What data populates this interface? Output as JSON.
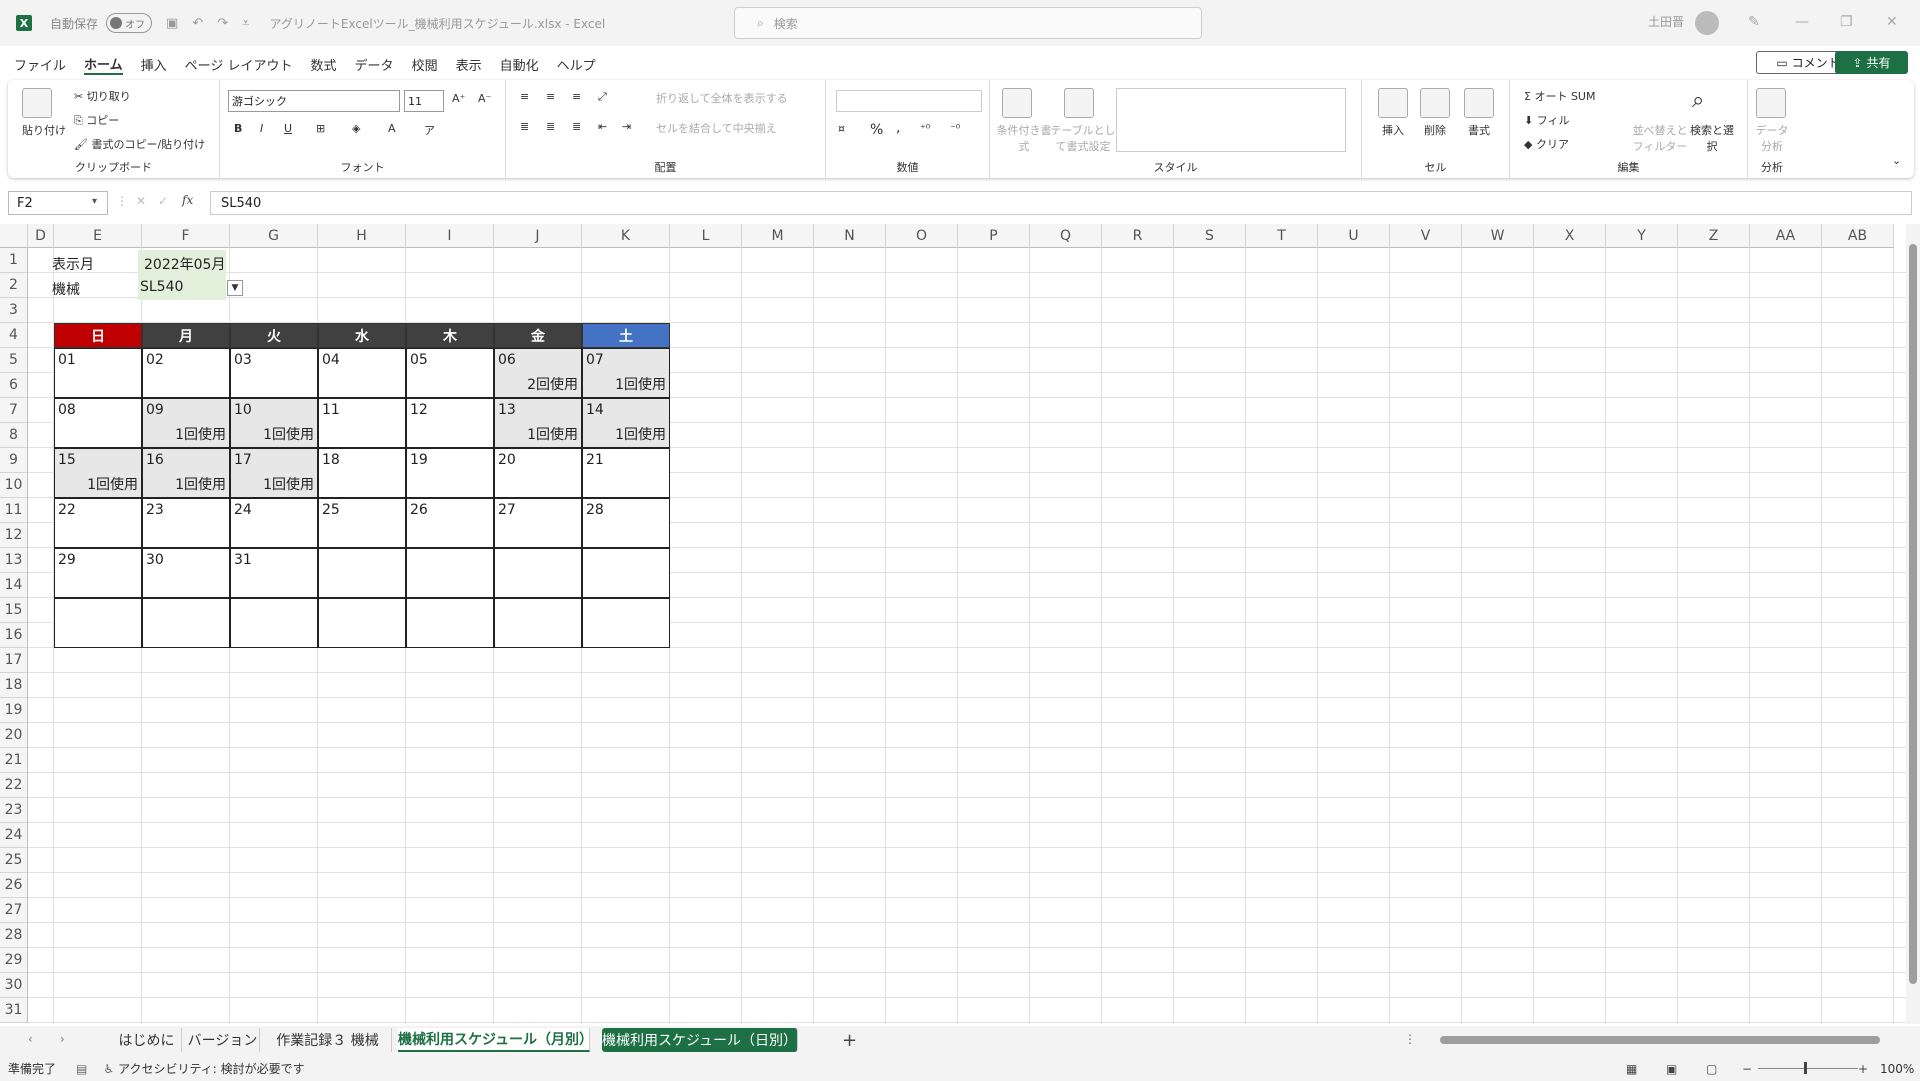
{
  "titlebar": {
    "autosave_label": "自動保存",
    "autosave_state": "オフ",
    "doc_title": "アグリノートExcelツール_機械利用スケジュール.xlsx  -  Excel",
    "search_placeholder": "検索",
    "user_name": "土田晋"
  },
  "menu": [
    "ファイル",
    "ホーム",
    "挿入",
    "ページ レイアウト",
    "数式",
    "データ",
    "校閲",
    "表示",
    "自動化",
    "ヘルプ"
  ],
  "menu_active": "ホーム",
  "buttons": {
    "comment": "コメント",
    "share": "共有"
  },
  "ribbon": {
    "clipboard": {
      "label": "クリップボード",
      "paste": "貼り付け",
      "cut": "切り取り",
      "copy": "コピー",
      "format_painter": "書式のコピー/貼り付け"
    },
    "font": {
      "label": "フォント",
      "font_name": "游ゴシック",
      "font_size": "11",
      "bold": "B",
      "italic": "I",
      "underline": "U"
    },
    "alignment": {
      "label": "配置",
      "wrap": "折り返して全体を表示する",
      "merge": "セルを結合して中央揃え"
    },
    "number": {
      "label": "数値",
      "percent": "%",
      "comma": ","
    },
    "styles": {
      "label": "スタイル",
      "cond_format": "条件付き書式",
      "table_format": "テーブルとして書式設定"
    },
    "cells": {
      "label": "セル",
      "insert": "挿入",
      "delete": "削除",
      "format": "書式"
    },
    "editing": {
      "label": "編集",
      "autosum": "オート SUM",
      "fill": "フィル",
      "clear": "クリア",
      "sort": "並べ替えとフィルター",
      "find": "検索と選択"
    },
    "analysis": {
      "label": "分析",
      "data_analysis": "データ分析"
    }
  },
  "formula": {
    "name_box": "F2",
    "fx": "fx",
    "content": "SL540"
  },
  "columns": [
    "D",
    "E",
    "F",
    "G",
    "H",
    "I",
    "J",
    "K",
    "L",
    "M",
    "N",
    "O",
    "P",
    "Q",
    "R",
    "S",
    "T",
    "U",
    "V",
    "W",
    "X",
    "Y",
    "Z",
    "AA",
    "AB"
  ],
  "rows": [
    "1",
    "2",
    "3",
    "4",
    "5",
    "6",
    "7",
    "8",
    "9",
    "10",
    "11",
    "12",
    "13",
    "14",
    "15",
    "16",
    "17",
    "18",
    "19",
    "20",
    "21",
    "22",
    "23",
    "24",
    "25",
    "26",
    "27",
    "28",
    "29",
    "30",
    "31"
  ],
  "sheet": {
    "month_label": "表示月",
    "month_value": "2022年05月",
    "machine_label": "機械",
    "machine_value": "SL540"
  },
  "calendar": {
    "days": [
      "日",
      "月",
      "火",
      "水",
      "木",
      "金",
      "土"
    ],
    "day_colors": [
      "#c00000",
      "#404040",
      "#404040",
      "#404040",
      "#404040",
      "#404040",
      "#4472c4"
    ],
    "weeks": [
      [
        {
          "d": "01",
          "u": ""
        },
        {
          "d": "02",
          "u": ""
        },
        {
          "d": "03",
          "u": ""
        },
        {
          "d": "04",
          "u": ""
        },
        {
          "d": "05",
          "u": ""
        },
        {
          "d": "06",
          "u": "2回使用"
        },
        {
          "d": "07",
          "u": "1回使用"
        }
      ],
      [
        {
          "d": "08",
          "u": ""
        },
        {
          "d": "09",
          "u": "1回使用"
        },
        {
          "d": "10",
          "u": "1回使用"
        },
        {
          "d": "11",
          "u": ""
        },
        {
          "d": "12",
          "u": ""
        },
        {
          "d": "13",
          "u": "1回使用"
        },
        {
          "d": "14",
          "u": "1回使用"
        }
      ],
      [
        {
          "d": "15",
          "u": "1回使用"
        },
        {
          "d": "16",
          "u": "1回使用"
        },
        {
          "d": "17",
          "u": "1回使用"
        },
        {
          "d": "18",
          "u": ""
        },
        {
          "d": "19",
          "u": ""
        },
        {
          "d": "20",
          "u": ""
        },
        {
          "d": "21",
          "u": ""
        }
      ],
      [
        {
          "d": "22",
          "u": ""
        },
        {
          "d": "23",
          "u": ""
        },
        {
          "d": "24",
          "u": ""
        },
        {
          "d": "25",
          "u": ""
        },
        {
          "d": "26",
          "u": ""
        },
        {
          "d": "27",
          "u": ""
        },
        {
          "d": "28",
          "u": ""
        }
      ],
      [
        {
          "d": "29",
          "u": ""
        },
        {
          "d": "30",
          "u": ""
        },
        {
          "d": "31",
          "u": ""
        },
        {
          "d": "",
          "u": ""
        },
        {
          "d": "",
          "u": ""
        },
        {
          "d": "",
          "u": ""
        },
        {
          "d": "",
          "u": ""
        }
      ],
      [
        {
          "d": "",
          "u": ""
        },
        {
          "d": "",
          "u": ""
        },
        {
          "d": "",
          "u": ""
        },
        {
          "d": "",
          "u": ""
        },
        {
          "d": "",
          "u": ""
        },
        {
          "d": "",
          "u": ""
        },
        {
          "d": "",
          "u": ""
        }
      ]
    ]
  },
  "tabs": [
    "はじめに",
    "バージョン",
    "作業記録３ 機械",
    "機械利用スケジュール（月別）",
    "機械利用スケジュール（日別）"
  ],
  "add_sheet": "+",
  "status": {
    "ready": "準備完了",
    "accessibility": "アクセシビリティ: 検討が必要です",
    "zoom": "100%"
  }
}
